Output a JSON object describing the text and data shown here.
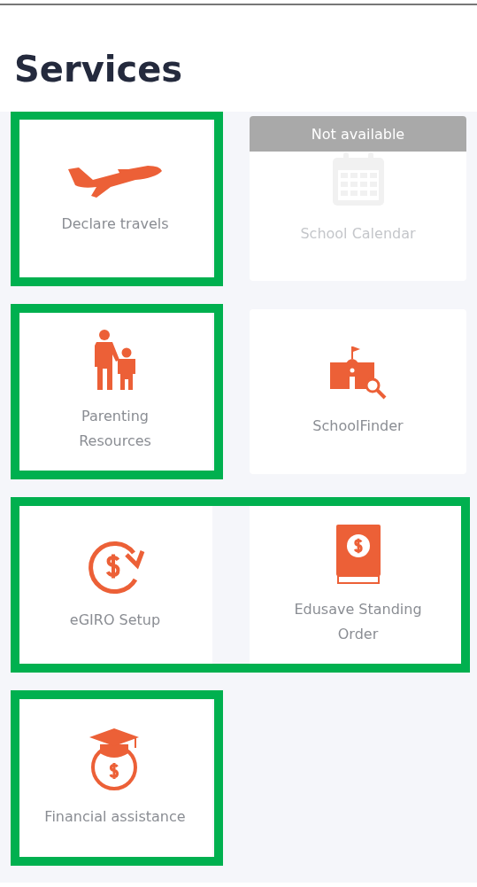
{
  "title": "Services",
  "rows": [
    {
      "tiles": [
        {
          "label": "Declare travels",
          "disabled": false,
          "highlighted": true
        },
        {
          "label": "School Calendar",
          "disabled": true,
          "banner": "Not available",
          "highlighted": false
        }
      ]
    },
    {
      "tiles": [
        {
          "label": "Parenting Resources",
          "disabled": false,
          "highlighted": true
        },
        {
          "label": "SchoolFinder",
          "disabled": false,
          "highlighted": false
        }
      ]
    },
    {
      "tiles": [
        {
          "label": "eGIRO Setup",
          "disabled": false,
          "highlighted": true
        },
        {
          "label": "Edusave Standing Order",
          "disabled": false,
          "highlighted": true
        }
      ]
    },
    {
      "tiles": [
        {
          "label": "Financial assistance",
          "disabled": false,
          "highlighted": true
        }
      ]
    }
  ]
}
